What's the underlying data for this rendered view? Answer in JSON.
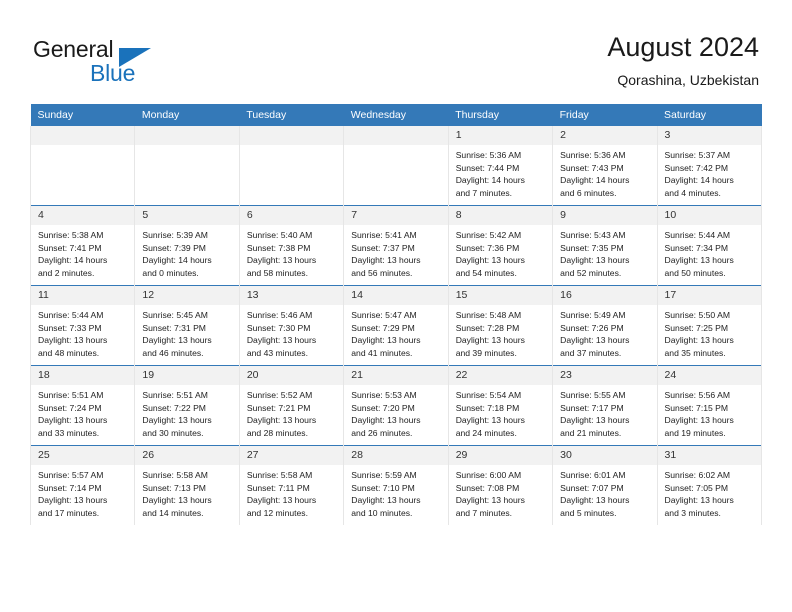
{
  "brand": {
    "name_line1": "General",
    "name_line2": "Blue",
    "accent_color": "#1a72bb"
  },
  "header": {
    "title": "August 2024",
    "location": "Qorashina, Uzbekistan"
  },
  "theme": {
    "header_row_bg": "#3479b8",
    "daynum_bg": "#f2f2f2",
    "row_divider": "#3479b8",
    "text_color": "#222222"
  },
  "weekdays": [
    "Sunday",
    "Monday",
    "Tuesday",
    "Wednesday",
    "Thursday",
    "Friday",
    "Saturday"
  ],
  "labels": {
    "sunrise_prefix": "Sunrise:",
    "sunset_prefix": "Sunset:",
    "daylight_prefix": "Daylight:"
  },
  "weeks": [
    [
      {
        "day": "",
        "blank": true
      },
      {
        "day": "",
        "blank": true
      },
      {
        "day": "",
        "blank": true
      },
      {
        "day": "",
        "blank": true
      },
      {
        "day": "1",
        "sunrise": "Sunrise: 5:36 AM",
        "sunset": "Sunset: 7:44 PM",
        "daylight_l1": "Daylight: 14 hours",
        "daylight_l2": "and 7 minutes."
      },
      {
        "day": "2",
        "sunrise": "Sunrise: 5:36 AM",
        "sunset": "Sunset: 7:43 PM",
        "daylight_l1": "Daylight: 14 hours",
        "daylight_l2": "and 6 minutes."
      },
      {
        "day": "3",
        "sunrise": "Sunrise: 5:37 AM",
        "sunset": "Sunset: 7:42 PM",
        "daylight_l1": "Daylight: 14 hours",
        "daylight_l2": "and 4 minutes."
      }
    ],
    [
      {
        "day": "4",
        "sunrise": "Sunrise: 5:38 AM",
        "sunset": "Sunset: 7:41 PM",
        "daylight_l1": "Daylight: 14 hours",
        "daylight_l2": "and 2 minutes."
      },
      {
        "day": "5",
        "sunrise": "Sunrise: 5:39 AM",
        "sunset": "Sunset: 7:39 PM",
        "daylight_l1": "Daylight: 14 hours",
        "daylight_l2": "and 0 minutes."
      },
      {
        "day": "6",
        "sunrise": "Sunrise: 5:40 AM",
        "sunset": "Sunset: 7:38 PM",
        "daylight_l1": "Daylight: 13 hours",
        "daylight_l2": "and 58 minutes."
      },
      {
        "day": "7",
        "sunrise": "Sunrise: 5:41 AM",
        "sunset": "Sunset: 7:37 PM",
        "daylight_l1": "Daylight: 13 hours",
        "daylight_l2": "and 56 minutes."
      },
      {
        "day": "8",
        "sunrise": "Sunrise: 5:42 AM",
        "sunset": "Sunset: 7:36 PM",
        "daylight_l1": "Daylight: 13 hours",
        "daylight_l2": "and 54 minutes."
      },
      {
        "day": "9",
        "sunrise": "Sunrise: 5:43 AM",
        "sunset": "Sunset: 7:35 PM",
        "daylight_l1": "Daylight: 13 hours",
        "daylight_l2": "and 52 minutes."
      },
      {
        "day": "10",
        "sunrise": "Sunrise: 5:44 AM",
        "sunset": "Sunset: 7:34 PM",
        "daylight_l1": "Daylight: 13 hours",
        "daylight_l2": "and 50 minutes."
      }
    ],
    [
      {
        "day": "11",
        "sunrise": "Sunrise: 5:44 AM",
        "sunset": "Sunset: 7:33 PM",
        "daylight_l1": "Daylight: 13 hours",
        "daylight_l2": "and 48 minutes."
      },
      {
        "day": "12",
        "sunrise": "Sunrise: 5:45 AM",
        "sunset": "Sunset: 7:31 PM",
        "daylight_l1": "Daylight: 13 hours",
        "daylight_l2": "and 46 minutes."
      },
      {
        "day": "13",
        "sunrise": "Sunrise: 5:46 AM",
        "sunset": "Sunset: 7:30 PM",
        "daylight_l1": "Daylight: 13 hours",
        "daylight_l2": "and 43 minutes."
      },
      {
        "day": "14",
        "sunrise": "Sunrise: 5:47 AM",
        "sunset": "Sunset: 7:29 PM",
        "daylight_l1": "Daylight: 13 hours",
        "daylight_l2": "and 41 minutes."
      },
      {
        "day": "15",
        "sunrise": "Sunrise: 5:48 AM",
        "sunset": "Sunset: 7:28 PM",
        "daylight_l1": "Daylight: 13 hours",
        "daylight_l2": "and 39 minutes."
      },
      {
        "day": "16",
        "sunrise": "Sunrise: 5:49 AM",
        "sunset": "Sunset: 7:26 PM",
        "daylight_l1": "Daylight: 13 hours",
        "daylight_l2": "and 37 minutes."
      },
      {
        "day": "17",
        "sunrise": "Sunrise: 5:50 AM",
        "sunset": "Sunset: 7:25 PM",
        "daylight_l1": "Daylight: 13 hours",
        "daylight_l2": "and 35 minutes."
      }
    ],
    [
      {
        "day": "18",
        "sunrise": "Sunrise: 5:51 AM",
        "sunset": "Sunset: 7:24 PM",
        "daylight_l1": "Daylight: 13 hours",
        "daylight_l2": "and 33 minutes."
      },
      {
        "day": "19",
        "sunrise": "Sunrise: 5:51 AM",
        "sunset": "Sunset: 7:22 PM",
        "daylight_l1": "Daylight: 13 hours",
        "daylight_l2": "and 30 minutes."
      },
      {
        "day": "20",
        "sunrise": "Sunrise: 5:52 AM",
        "sunset": "Sunset: 7:21 PM",
        "daylight_l1": "Daylight: 13 hours",
        "daylight_l2": "and 28 minutes."
      },
      {
        "day": "21",
        "sunrise": "Sunrise: 5:53 AM",
        "sunset": "Sunset: 7:20 PM",
        "daylight_l1": "Daylight: 13 hours",
        "daylight_l2": "and 26 minutes."
      },
      {
        "day": "22",
        "sunrise": "Sunrise: 5:54 AM",
        "sunset": "Sunset: 7:18 PM",
        "daylight_l1": "Daylight: 13 hours",
        "daylight_l2": "and 24 minutes."
      },
      {
        "day": "23",
        "sunrise": "Sunrise: 5:55 AM",
        "sunset": "Sunset: 7:17 PM",
        "daylight_l1": "Daylight: 13 hours",
        "daylight_l2": "and 21 minutes."
      },
      {
        "day": "24",
        "sunrise": "Sunrise: 5:56 AM",
        "sunset": "Sunset: 7:15 PM",
        "daylight_l1": "Daylight: 13 hours",
        "daylight_l2": "and 19 minutes."
      }
    ],
    [
      {
        "day": "25",
        "sunrise": "Sunrise: 5:57 AM",
        "sunset": "Sunset: 7:14 PM",
        "daylight_l1": "Daylight: 13 hours",
        "daylight_l2": "and 17 minutes."
      },
      {
        "day": "26",
        "sunrise": "Sunrise: 5:58 AM",
        "sunset": "Sunset: 7:13 PM",
        "daylight_l1": "Daylight: 13 hours",
        "daylight_l2": "and 14 minutes."
      },
      {
        "day": "27",
        "sunrise": "Sunrise: 5:58 AM",
        "sunset": "Sunset: 7:11 PM",
        "daylight_l1": "Daylight: 13 hours",
        "daylight_l2": "and 12 minutes."
      },
      {
        "day": "28",
        "sunrise": "Sunrise: 5:59 AM",
        "sunset": "Sunset: 7:10 PM",
        "daylight_l1": "Daylight: 13 hours",
        "daylight_l2": "and 10 minutes."
      },
      {
        "day": "29",
        "sunrise": "Sunrise: 6:00 AM",
        "sunset": "Sunset: 7:08 PM",
        "daylight_l1": "Daylight: 13 hours",
        "daylight_l2": "and 7 minutes."
      },
      {
        "day": "30",
        "sunrise": "Sunrise: 6:01 AM",
        "sunset": "Sunset: 7:07 PM",
        "daylight_l1": "Daylight: 13 hours",
        "daylight_l2": "and 5 minutes."
      },
      {
        "day": "31",
        "sunrise": "Sunrise: 6:02 AM",
        "sunset": "Sunset: 7:05 PM",
        "daylight_l1": "Daylight: 13 hours",
        "daylight_l2": "and 3 minutes."
      }
    ]
  ]
}
